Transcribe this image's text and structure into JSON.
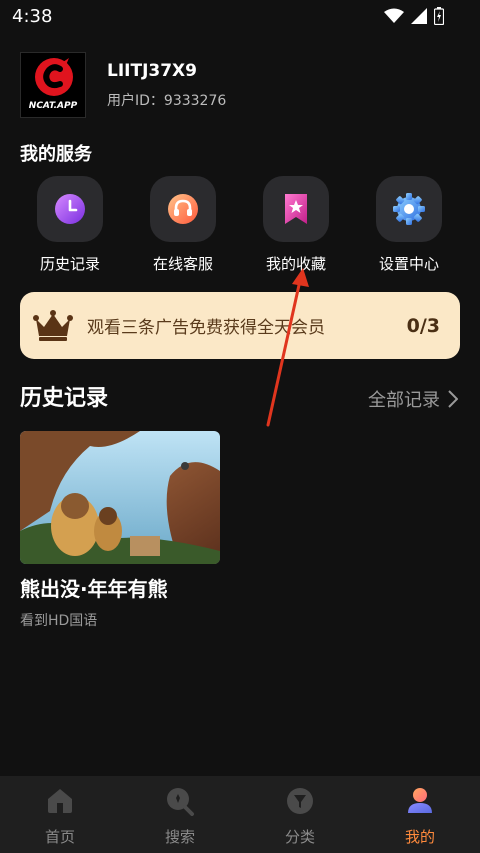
{
  "status": {
    "time": "4:38"
  },
  "profile": {
    "logo_text": "NCAT.APP",
    "username": "LIITJ37X9",
    "user_id": "用户ID：9333276"
  },
  "services": {
    "title": "我的服务",
    "items": [
      {
        "label": "历史记录",
        "icon": "clock-icon"
      },
      {
        "label": "在线客服",
        "icon": "headset-icon"
      },
      {
        "label": "我的收藏",
        "icon": "bookmark-star-icon"
      },
      {
        "label": "设置中心",
        "icon": "gear-icon"
      }
    ]
  },
  "vip_banner": {
    "text": "观看三条广告免费获得全天会员",
    "count": "0/3",
    "icon": "crown-icon"
  },
  "history": {
    "title": "历史记录",
    "all_link": "全部记录",
    "items": [
      {
        "name": "熊出没·年年有熊",
        "subtitle": "看到HD国语"
      }
    ]
  },
  "bottom_nav": {
    "items": [
      {
        "label": "首页",
        "icon": "home-icon",
        "active": false
      },
      {
        "label": "搜索",
        "icon": "search-icon",
        "active": false
      },
      {
        "label": "分类",
        "icon": "category-icon",
        "active": false
      },
      {
        "label": "我的",
        "icon": "profile-icon",
        "active": true
      }
    ]
  },
  "colors": {
    "background": "#111111",
    "accent": "#ff8a3c",
    "vip_bg": "#fbe8c7"
  }
}
